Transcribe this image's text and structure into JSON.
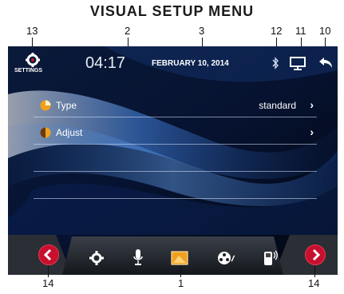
{
  "heading": "VISUAL SETUP MENU",
  "callouts": {
    "c13": "13",
    "c2": "2",
    "c3": "3",
    "c12": "12",
    "c11": "11",
    "c10": "10",
    "c14_left": "14",
    "c1": "1",
    "c14_right": "14"
  },
  "status_bar": {
    "settings_label": "SETTINGS",
    "time": "04:17",
    "date": "FEBRUARY 10, 2014",
    "icons": [
      "settings-icon",
      "bluetooth-icon",
      "monitor-icon",
      "back-arrow-icon"
    ]
  },
  "menu": {
    "items": [
      {
        "label": "Type",
        "value": "standard",
        "chevron": "›",
        "icon": "type-dot-icon"
      },
      {
        "label": "Adjust",
        "value": "",
        "chevron": "›",
        "icon": "adjust-dot-icon"
      }
    ]
  },
  "dock": {
    "items": [
      "previous-page-icon",
      "gear-icon",
      "microphone-icon",
      "visual-setup-icon",
      "media-reel-icon",
      "phone-icon",
      "next-page-icon"
    ],
    "selected": "visual-setup-icon"
  },
  "colors": {
    "accent_red": "#c8102e",
    "selected_orange": "#f0a020",
    "bg_dark": "#040a1a",
    "wave_blue": "#2a6fd0"
  }
}
